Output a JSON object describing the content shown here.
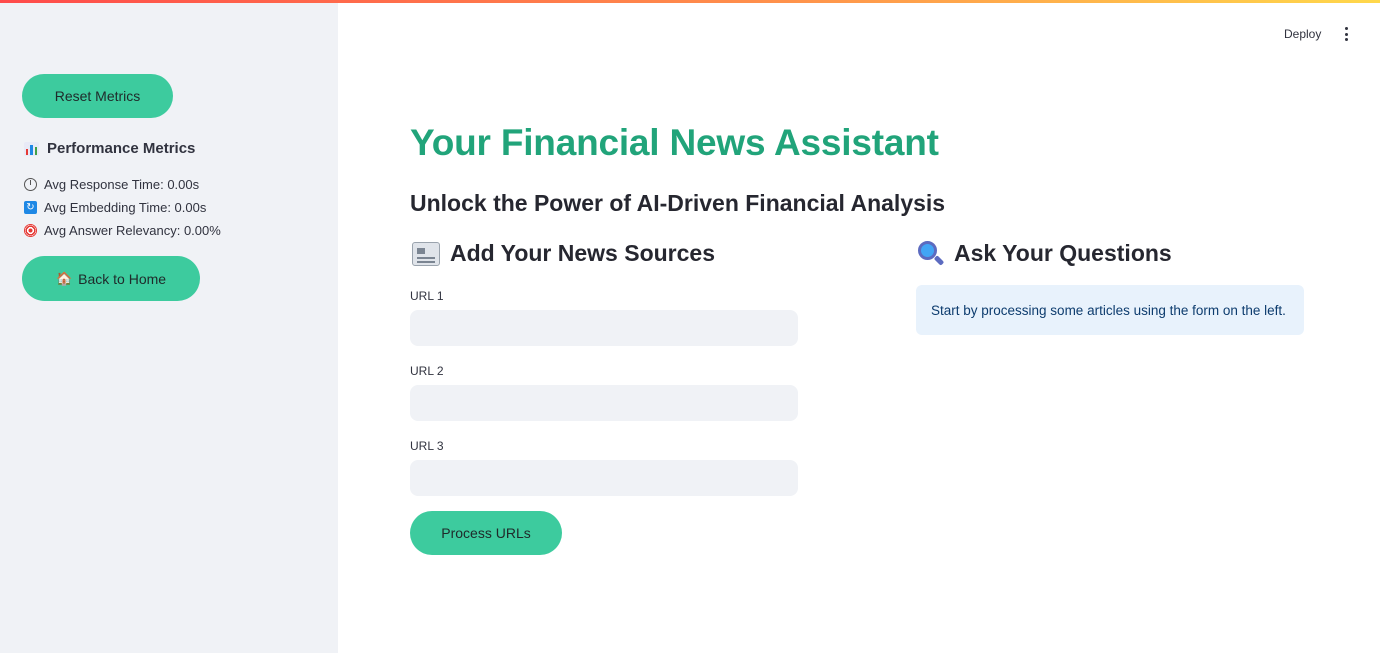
{
  "sidebar": {
    "reset_label": "Reset Metrics",
    "metrics_title": "Performance Metrics",
    "metrics": [
      {
        "label": "Avg Response Time: 0.00s",
        "icon": "stopwatch-icon"
      },
      {
        "label": "Avg Embedding Time: 0.00s",
        "icon": "sync-icon"
      },
      {
        "label": "Avg Answer Relevancy: 0.00%",
        "icon": "target-icon"
      }
    ],
    "home_label": "Back to Home",
    "home_icon": "🏠"
  },
  "header": {
    "deploy_label": "Deploy"
  },
  "main": {
    "title": "Your Financial News Assistant",
    "subtitle": "Unlock the Power of AI-Driven Financial Analysis",
    "sources": {
      "heading": "Add Your News Sources",
      "fields": [
        {
          "label": "URL 1",
          "value": ""
        },
        {
          "label": "URL 2",
          "value": ""
        },
        {
          "label": "URL 3",
          "value": ""
        }
      ],
      "process_label": "Process URLs"
    },
    "questions": {
      "heading": "Ask Your Questions",
      "info": "Start by processing some articles using the form on the left."
    }
  },
  "colors": {
    "accent": "#3dcb9e",
    "title": "#21a47a",
    "sidebar_bg": "#f0f2f6",
    "info_bg": "#e8f2fc"
  }
}
